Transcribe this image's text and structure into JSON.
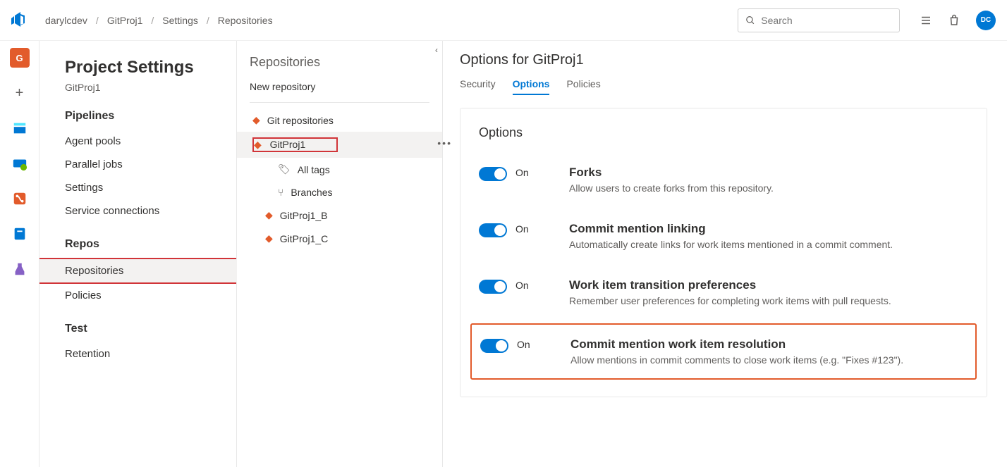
{
  "breadcrumb": [
    "darylcdev",
    "GitProj1",
    "Settings",
    "Repositories"
  ],
  "search": {
    "placeholder": "Search"
  },
  "avatar": "DC",
  "settings": {
    "title": "Project Settings",
    "project": "GitProj1",
    "groups": [
      {
        "name": "Pipelines",
        "items": [
          "Agent pools",
          "Parallel jobs",
          "Settings",
          "Service connections"
        ]
      },
      {
        "name": "Repos",
        "items": [
          "Repositories",
          "Policies"
        ],
        "highlighted": "Repositories"
      },
      {
        "name": "Test",
        "items": [
          "Retention"
        ]
      }
    ]
  },
  "repoList": {
    "title": "Repositories",
    "newRepo": "New repository",
    "items": [
      {
        "label": "Git repositories",
        "type": "root"
      },
      {
        "label": "GitProj1",
        "type": "repo",
        "selected": true,
        "highlighted": true
      },
      {
        "label": "All tags",
        "type": "tags"
      },
      {
        "label": "Branches",
        "type": "branches"
      },
      {
        "label": "GitProj1_B",
        "type": "repo"
      },
      {
        "label": "GitProj1_C",
        "type": "repo"
      }
    ]
  },
  "content": {
    "heading": "Options for GitProj1",
    "tabs": [
      "Security",
      "Options",
      "Policies"
    ],
    "activeTab": "Options",
    "sectionTitle": "Options",
    "options": [
      {
        "on": "On",
        "title": "Forks",
        "desc": "Allow users to create forks from this repository."
      },
      {
        "on": "On",
        "title": "Commit mention linking",
        "desc": "Automatically create links for work items mentioned in a commit comment."
      },
      {
        "on": "On",
        "title": "Work item transition preferences",
        "desc": "Remember user preferences for completing work items with pull requests."
      },
      {
        "on": "On",
        "title": "Commit mention work item resolution",
        "desc": "Allow mentions in commit comments to close work items (e.g. \"Fixes #123\").",
        "boxed": true
      }
    ]
  }
}
